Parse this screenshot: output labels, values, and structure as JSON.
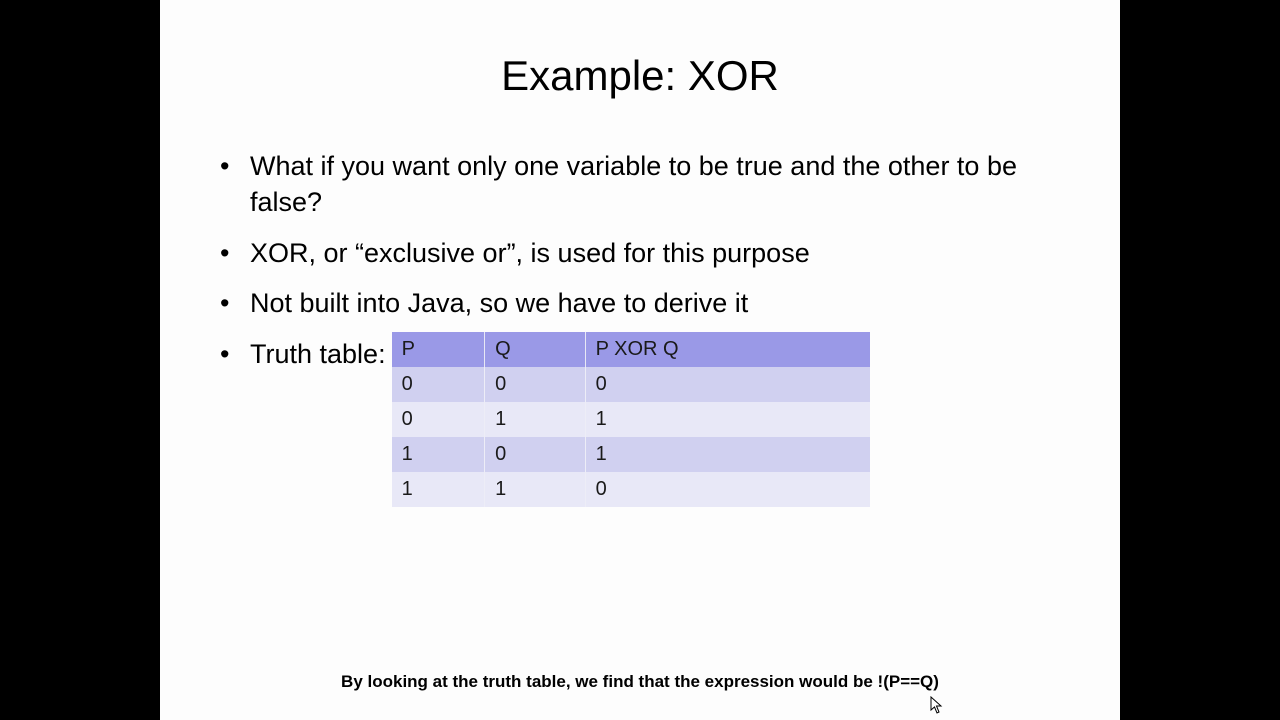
{
  "title": "Example: XOR",
  "bullets": [
    "What if you want only one variable to be true and the other to be false?",
    "XOR, or “exclusive or”, is used for this purpose",
    "Not built into Java, so we have to derive it",
    "Truth table:"
  ],
  "table": {
    "headers": [
      "P",
      "Q",
      "P XOR Q"
    ],
    "rows": [
      [
        "0",
        "0",
        "0"
      ],
      [
        "0",
        "1",
        "1"
      ],
      [
        "1",
        "0",
        "1"
      ],
      [
        "1",
        "1",
        "0"
      ]
    ]
  },
  "footer": "By looking at the truth table, we find that the expression would be !(P==Q)"
}
